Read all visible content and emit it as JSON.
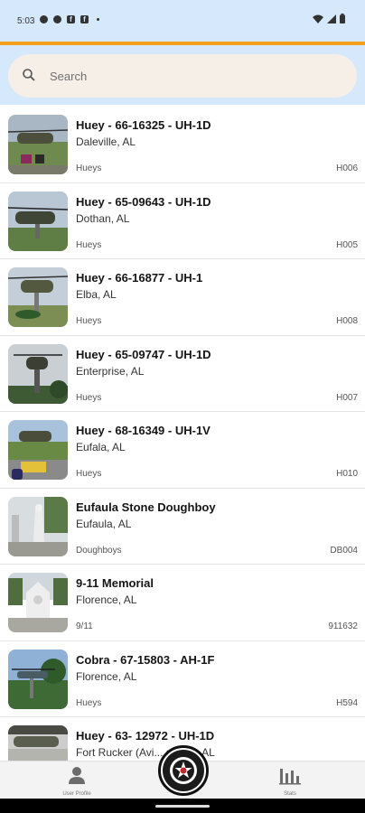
{
  "status_bar": {
    "time": "5:03"
  },
  "search": {
    "placeholder": "Search"
  },
  "items": [
    {
      "title": "Huey - 66-16325 - UH-1D",
      "location": "Daleville, AL",
      "category": "Hueys",
      "code": "H006"
    },
    {
      "title": "Huey - 65-09643 - UH-1D",
      "location": "Dothan, AL",
      "category": "Hueys",
      "code": "H005"
    },
    {
      "title": "Huey - 66-16877 - UH-1",
      "location": "Elba, AL",
      "category": "Hueys",
      "code": "H008"
    },
    {
      "title": "Huey - 65-09747 - UH-1D",
      "location": "Enterprise, AL",
      "category": "Hueys",
      "code": "H007"
    },
    {
      "title": "Huey - 68-16349 - UH-1V",
      "location": "Eufala, AL",
      "category": "Hueys",
      "code": "H010"
    },
    {
      "title": "Eufaula Stone Doughboy",
      "location": "Eufaula, AL",
      "category": "Doughboys",
      "code": "DB004"
    },
    {
      "title": "9-11 Memorial",
      "location": "Florence, AL",
      "category": "9/11",
      "code": "911632"
    },
    {
      "title": "Cobra - 67-15803 - AH-1F",
      "location": "Florence, AL",
      "category": "Hueys",
      "code": "H594"
    },
    {
      "title": "Huey - 63- 12972 - UH-1D",
      "location": "Fort Rucker (Avi... seum), AL",
      "category": "",
      "code": ""
    }
  ],
  "bottom_nav": {
    "left_label": "User Profile",
    "right_label": "Stats"
  },
  "colors": {
    "header": "#d6e8fb",
    "accent": "#f3a01c",
    "search_bg": "#f6efe7"
  }
}
